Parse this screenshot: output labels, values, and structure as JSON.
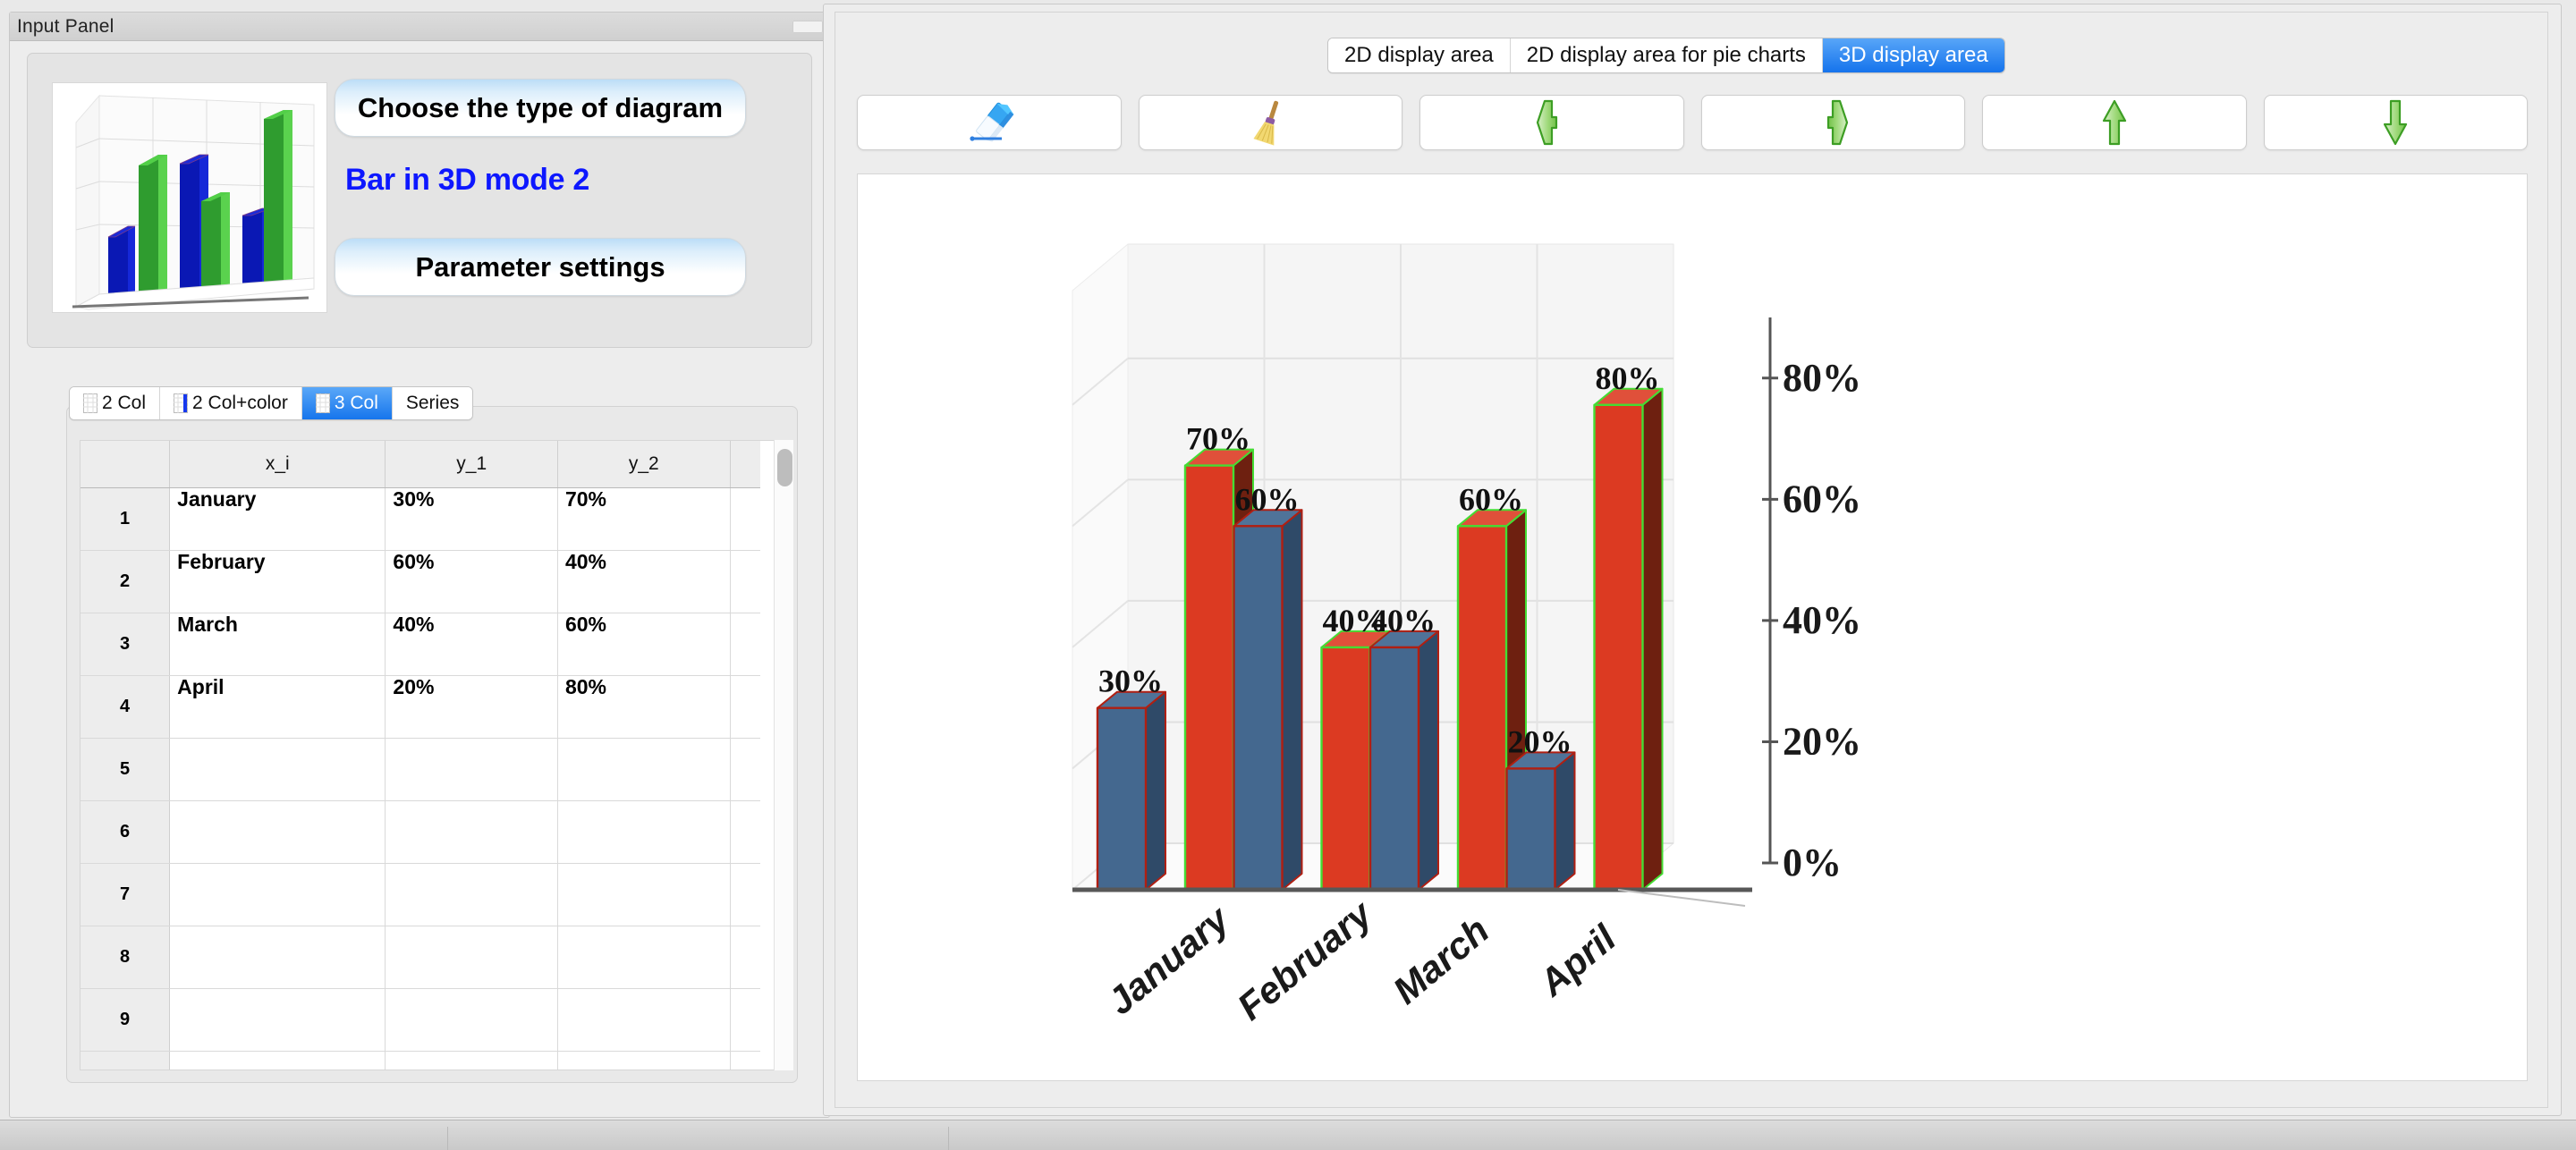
{
  "input_panel": {
    "title": "Input Panel",
    "minimize_icon": "minimize-icon",
    "choose_type_label": "Choose the type of diagram",
    "diagram_mode_label": "Bar in 3D mode 2",
    "parameter_settings_label": "Parameter settings",
    "preview_icon": "bar-3d-preview-thumbnail",
    "table_tabs": [
      {
        "label": "2 Col",
        "active": false,
        "icon": "grid-2col-icon"
      },
      {
        "label": "2 Col+color",
        "active": false,
        "icon": "grid-2col-color-icon"
      },
      {
        "label": "3 Col",
        "active": true,
        "icon": "grid-3col-icon"
      },
      {
        "label": "Series",
        "active": false,
        "icon": "grid-series-icon"
      }
    ],
    "table": {
      "headers": [
        "",
        "x_i",
        "y_1",
        "y_2"
      ],
      "rows": [
        {
          "n": "1",
          "x_i": "January",
          "y_1": "30%",
          "y_2": "70%"
        },
        {
          "n": "2",
          "x_i": "February",
          "y_1": "60%",
          "y_2": "40%"
        },
        {
          "n": "3",
          "x_i": "March",
          "y_1": "40%",
          "y_2": "60%"
        },
        {
          "n": "4",
          "x_i": "April",
          "y_1": "20%",
          "y_2": "80%"
        },
        {
          "n": "5",
          "x_i": "",
          "y_1": "",
          "y_2": ""
        },
        {
          "n": "6",
          "x_i": "",
          "y_1": "",
          "y_2": ""
        },
        {
          "n": "7",
          "x_i": "",
          "y_1": "",
          "y_2": ""
        },
        {
          "n": "8",
          "x_i": "",
          "y_1": "",
          "y_2": ""
        },
        {
          "n": "9",
          "x_i": "",
          "y_1": "",
          "y_2": ""
        },
        {
          "n": "",
          "x_i": "",
          "y_1": "",
          "y_2": ""
        }
      ]
    }
  },
  "display_panel": {
    "area_tabs": [
      {
        "label": "2D display area",
        "active": false
      },
      {
        "label": "2D display area for pie charts",
        "active": false
      },
      {
        "label": "3D display area",
        "active": true
      }
    ],
    "toolbar": [
      {
        "name": "eraser-button",
        "icon": "eraser-icon"
      },
      {
        "name": "broom-clear-button",
        "icon": "broom-icon"
      },
      {
        "name": "rotate-left-button",
        "icon": "arrow-left-icon"
      },
      {
        "name": "rotate-right-button",
        "icon": "arrow-right-icon"
      },
      {
        "name": "rotate-up-button",
        "icon": "arrow-up-icon"
      },
      {
        "name": "rotate-down-button",
        "icon": "arrow-down-icon"
      }
    ]
  },
  "colors": {
    "series1_face": "#44688F",
    "series1_edge": "#B01F12",
    "series2_face": "#DC3A22",
    "series2_edge": "#44DD33",
    "series2_side": "#6E2010",
    "accent_blue": "#1675ec",
    "mode_text": "#0d17ff",
    "panel_bg": "#ededed",
    "plot_bg": "#f4f4f4"
  },
  "chart_data": {
    "type": "bar",
    "title": "",
    "xlabel": "",
    "ylabel": "",
    "categories": [
      "January",
      "February",
      "March",
      "April"
    ],
    "series": [
      {
        "name": "y_1",
        "values": [
          30,
          60,
          40,
          20
        ],
        "labels": [
          "30%",
          "60%",
          "40%",
          "20%"
        ],
        "color": "#44688F"
      },
      {
        "name": "y_2",
        "values": [
          70,
          40,
          60,
          80
        ],
        "labels": [
          "70%",
          "40%",
          "60%",
          "80%"
        ],
        "color": "#DC3A22"
      }
    ],
    "ylim": [
      0,
      90
    ],
    "yticks": [
      0,
      20,
      40,
      60,
      80
    ],
    "ytick_labels": [
      "0%",
      "20%",
      "40%",
      "60%",
      "80%"
    ],
    "grid": true,
    "legend": "none",
    "projection": "3d",
    "x_label_rotation": -40
  }
}
